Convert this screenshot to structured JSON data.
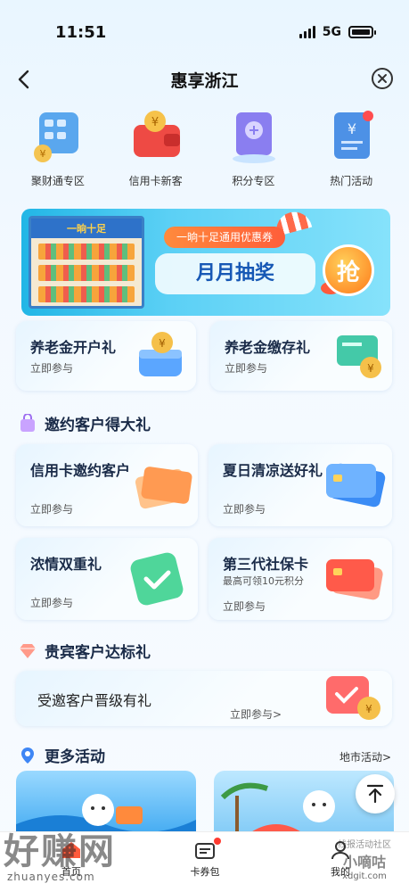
{
  "status": {
    "time": "11:51",
    "network": "5G"
  },
  "nav": {
    "title": "惠享浙江"
  },
  "quick_links": [
    {
      "label": "聚财通专区",
      "icon": "calculator-icon"
    },
    {
      "label": "信用卡新客",
      "icon": "wallet-coin-icon"
    },
    {
      "label": "积分专区",
      "icon": "passport-icon"
    },
    {
      "label": "热门活动",
      "icon": "invoice-icon"
    }
  ],
  "banner": {
    "store_sign": "一晌十足",
    "tag": "一晌十足通用优惠券",
    "headline": "月月抽奖",
    "button": "抢"
  },
  "pension": [
    {
      "title": "养老金开户礼",
      "cta": "立即参与",
      "icon": "coin-wallet-icon"
    },
    {
      "title": "养老金缴存礼",
      "cta": "立即参与",
      "icon": "card-coin-icon"
    }
  ],
  "invite_section": {
    "title": "邀约客户得大礼"
  },
  "invite_cards": [
    {
      "title": "信用卡邀约客户",
      "cta": "立即参与",
      "icon": "credit-cards-icon"
    },
    {
      "title": "夏日清凉送好礼",
      "cta": "立即参与",
      "icon": "blue-card-icon"
    },
    {
      "title": "浓情双重礼",
      "cta": "立即参与",
      "icon": "check-card-icon"
    },
    {
      "title": "第三代社保卡",
      "subtitle": "最高可领10元积分",
      "cta": "立即参与",
      "icon": "red-cards-icon"
    }
  ],
  "vip_section": {
    "title": "贵宾客户达标礼"
  },
  "vip_card": {
    "title": "受邀客户晋级有礼",
    "cta": "立即参与>",
    "icon": "wallet-check-icon"
  },
  "more_section": {
    "title": "更多活动",
    "link": "地市活动>"
  },
  "tabs": [
    {
      "label": "首页",
      "icon": "home-icon"
    },
    {
      "label": "卡券包",
      "icon": "coupon-icon"
    },
    {
      "label": "我的",
      "icon": "user-icon"
    }
  ],
  "watermark": {
    "text": "好赚网",
    "url": "zhuanyes.com",
    "right_top": "线报活动社区",
    "right_mid": "小嘀咕",
    "right_url": "xdgit.com"
  },
  "colors": {
    "accent": "#1758b5",
    "badge": "#ff3b30"
  }
}
